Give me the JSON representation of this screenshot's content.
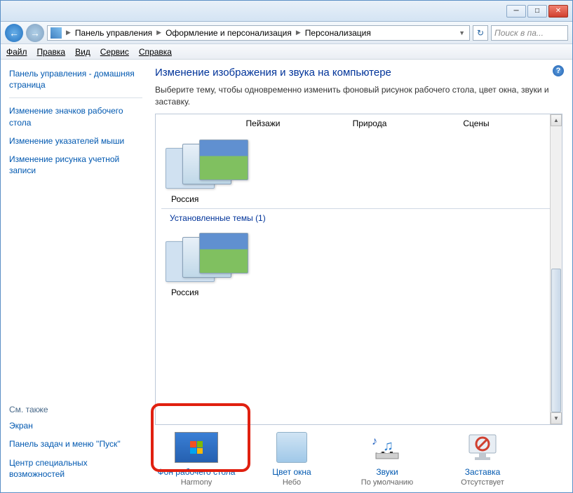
{
  "breadcrumb": {
    "root": "Панель управления",
    "mid": "Оформление и персонализация",
    "leaf": "Персонализация"
  },
  "search": {
    "placeholder": "Поиск в па..."
  },
  "menu": {
    "file": "Файл",
    "edit": "Правка",
    "view": "Вид",
    "service": "Сервис",
    "help": "Справка"
  },
  "sidebar": {
    "home": "Панель управления - домашняя страница",
    "icons": "Изменение значков рабочего стола",
    "cursors": "Изменение указателей мыши",
    "account_pic": "Изменение рисунка учетной записи",
    "see_also": "См. также",
    "screen": "Экран",
    "taskbar": "Панель задач и меню ''Пуск''",
    "ease": "Центр специальных возможностей"
  },
  "main": {
    "title": "Изменение изображения и звука на компьютере",
    "desc": "Выберите тему, чтобы одновременно изменить фоновый рисунок рабочего стола, цвет окна, звуки и заставку.",
    "row_labels": {
      "a": "Пейзажи",
      "b": "Природа",
      "c": "Сцены"
    },
    "russia": "Россия",
    "installed_hdr": "Установленные темы (1)"
  },
  "options": {
    "bg": {
      "title": "Фон рабочего стола",
      "sub": "Harmony"
    },
    "color": {
      "title": "Цвет окна",
      "sub": "Небо"
    },
    "sounds": {
      "title": "Звуки",
      "sub": "По умолчанию"
    },
    "saver": {
      "title": "Заставка",
      "sub": "Отсутствует"
    }
  }
}
